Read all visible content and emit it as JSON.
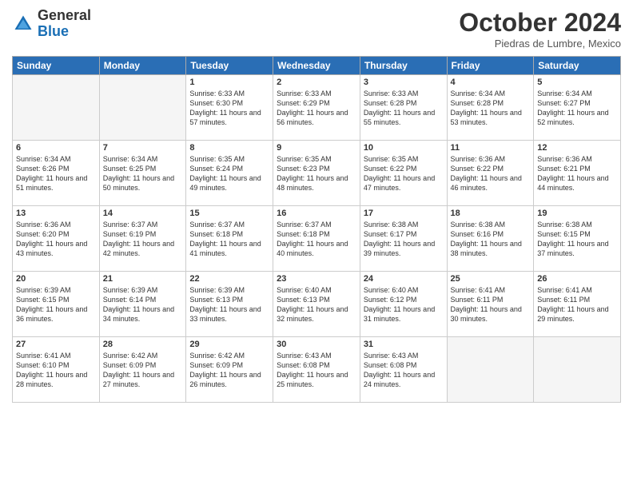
{
  "header": {
    "logo_general": "General",
    "logo_blue": "Blue",
    "month": "October 2024",
    "location": "Piedras de Lumbre, Mexico"
  },
  "days_of_week": [
    "Sunday",
    "Monday",
    "Tuesday",
    "Wednesday",
    "Thursday",
    "Friday",
    "Saturday"
  ],
  "weeks": [
    [
      {
        "day": "",
        "info": ""
      },
      {
        "day": "",
        "info": ""
      },
      {
        "day": "1",
        "sunrise": "6:33 AM",
        "sunset": "6:30 PM",
        "daylight": "11 hours and 57 minutes."
      },
      {
        "day": "2",
        "sunrise": "6:33 AM",
        "sunset": "6:29 PM",
        "daylight": "11 hours and 56 minutes."
      },
      {
        "day": "3",
        "sunrise": "6:33 AM",
        "sunset": "6:28 PM",
        "daylight": "11 hours and 55 minutes."
      },
      {
        "day": "4",
        "sunrise": "6:34 AM",
        "sunset": "6:28 PM",
        "daylight": "11 hours and 53 minutes."
      },
      {
        "day": "5",
        "sunrise": "6:34 AM",
        "sunset": "6:27 PM",
        "daylight": "11 hours and 52 minutes."
      }
    ],
    [
      {
        "day": "6",
        "sunrise": "6:34 AM",
        "sunset": "6:26 PM",
        "daylight": "11 hours and 51 minutes."
      },
      {
        "day": "7",
        "sunrise": "6:34 AM",
        "sunset": "6:25 PM",
        "daylight": "11 hours and 50 minutes."
      },
      {
        "day": "8",
        "sunrise": "6:35 AM",
        "sunset": "6:24 PM",
        "daylight": "11 hours and 49 minutes."
      },
      {
        "day": "9",
        "sunrise": "6:35 AM",
        "sunset": "6:23 PM",
        "daylight": "11 hours and 48 minutes."
      },
      {
        "day": "10",
        "sunrise": "6:35 AM",
        "sunset": "6:22 PM",
        "daylight": "11 hours and 47 minutes."
      },
      {
        "day": "11",
        "sunrise": "6:36 AM",
        "sunset": "6:22 PM",
        "daylight": "11 hours and 46 minutes."
      },
      {
        "day": "12",
        "sunrise": "6:36 AM",
        "sunset": "6:21 PM",
        "daylight": "11 hours and 44 minutes."
      }
    ],
    [
      {
        "day": "13",
        "sunrise": "6:36 AM",
        "sunset": "6:20 PM",
        "daylight": "11 hours and 43 minutes."
      },
      {
        "day": "14",
        "sunrise": "6:37 AM",
        "sunset": "6:19 PM",
        "daylight": "11 hours and 42 minutes."
      },
      {
        "day": "15",
        "sunrise": "6:37 AM",
        "sunset": "6:18 PM",
        "daylight": "11 hours and 41 minutes."
      },
      {
        "day": "16",
        "sunrise": "6:37 AM",
        "sunset": "6:18 PM",
        "daylight": "11 hours and 40 minutes."
      },
      {
        "day": "17",
        "sunrise": "6:38 AM",
        "sunset": "6:17 PM",
        "daylight": "11 hours and 39 minutes."
      },
      {
        "day": "18",
        "sunrise": "6:38 AM",
        "sunset": "6:16 PM",
        "daylight": "11 hours and 38 minutes."
      },
      {
        "day": "19",
        "sunrise": "6:38 AM",
        "sunset": "6:15 PM",
        "daylight": "11 hours and 37 minutes."
      }
    ],
    [
      {
        "day": "20",
        "sunrise": "6:39 AM",
        "sunset": "6:15 PM",
        "daylight": "11 hours and 36 minutes."
      },
      {
        "day": "21",
        "sunrise": "6:39 AM",
        "sunset": "6:14 PM",
        "daylight": "11 hours and 34 minutes."
      },
      {
        "day": "22",
        "sunrise": "6:39 AM",
        "sunset": "6:13 PM",
        "daylight": "11 hours and 33 minutes."
      },
      {
        "day": "23",
        "sunrise": "6:40 AM",
        "sunset": "6:13 PM",
        "daylight": "11 hours and 32 minutes."
      },
      {
        "day": "24",
        "sunrise": "6:40 AM",
        "sunset": "6:12 PM",
        "daylight": "11 hours and 31 minutes."
      },
      {
        "day": "25",
        "sunrise": "6:41 AM",
        "sunset": "6:11 PM",
        "daylight": "11 hours and 30 minutes."
      },
      {
        "day": "26",
        "sunrise": "6:41 AM",
        "sunset": "6:11 PM",
        "daylight": "11 hours and 29 minutes."
      }
    ],
    [
      {
        "day": "27",
        "sunrise": "6:41 AM",
        "sunset": "6:10 PM",
        "daylight": "11 hours and 28 minutes."
      },
      {
        "day": "28",
        "sunrise": "6:42 AM",
        "sunset": "6:09 PM",
        "daylight": "11 hours and 27 minutes."
      },
      {
        "day": "29",
        "sunrise": "6:42 AM",
        "sunset": "6:09 PM",
        "daylight": "11 hours and 26 minutes."
      },
      {
        "day": "30",
        "sunrise": "6:43 AM",
        "sunset": "6:08 PM",
        "daylight": "11 hours and 25 minutes."
      },
      {
        "day": "31",
        "sunrise": "6:43 AM",
        "sunset": "6:08 PM",
        "daylight": "11 hours and 24 minutes."
      },
      {
        "day": "",
        "info": ""
      },
      {
        "day": "",
        "info": ""
      }
    ]
  ]
}
